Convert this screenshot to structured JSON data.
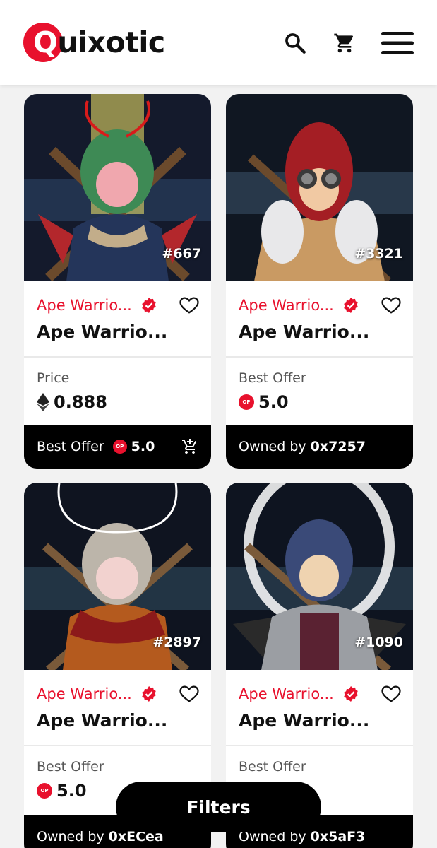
{
  "app": {
    "logo_first": "Q",
    "logo_rest": "uixotic"
  },
  "header": {
    "icons": [
      "search-icon",
      "cart-icon",
      "menu-icon"
    ]
  },
  "colors": {
    "accent": "#e8112d",
    "dark": "#000000"
  },
  "cards": [
    {
      "token_id": "#667",
      "collection": "Ape Warrio...",
      "name": "Ape Warrio...",
      "price_label": "Price",
      "price_currency": "eth-icon",
      "price_value": "0.888",
      "footer_label": "Best Offer",
      "footer_currency": "op-icon",
      "footer_value": "5.0",
      "footer_icon": "add-to-cart-icon"
    },
    {
      "token_id": "#3321",
      "collection": "Ape Warrio...",
      "name": "Ape Warrio...",
      "price_label": "Best Offer",
      "price_currency": "op-icon",
      "price_value": "5.0",
      "footer_label": "Owned by",
      "footer_value": "0x7257"
    },
    {
      "token_id": "#2897",
      "collection": "Ape Warrio...",
      "name": "Ape Warrio...",
      "price_label": "Best Offer",
      "price_currency": "op-icon",
      "price_value": "5.0",
      "footer_label": "Owned by",
      "footer_value": "0xECea"
    },
    {
      "token_id": "#1090",
      "collection": "Ape Warrio...",
      "name": "Ape Warrio...",
      "price_label": "Best Offer",
      "price_currency": "op-icon",
      "price_value": "",
      "footer_label": "Owned by",
      "footer_value": "0x5aF3"
    }
  ],
  "op_badge_text": "OP",
  "filters_label": "Filters"
}
